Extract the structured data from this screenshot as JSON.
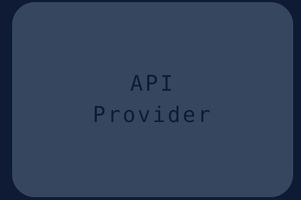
{
  "node": {
    "lines": [
      "API",
      "Provider"
    ]
  },
  "colors": {
    "background": "#0f1b34",
    "node_fill": "#37465f",
    "node_text": "#0f1b34"
  }
}
